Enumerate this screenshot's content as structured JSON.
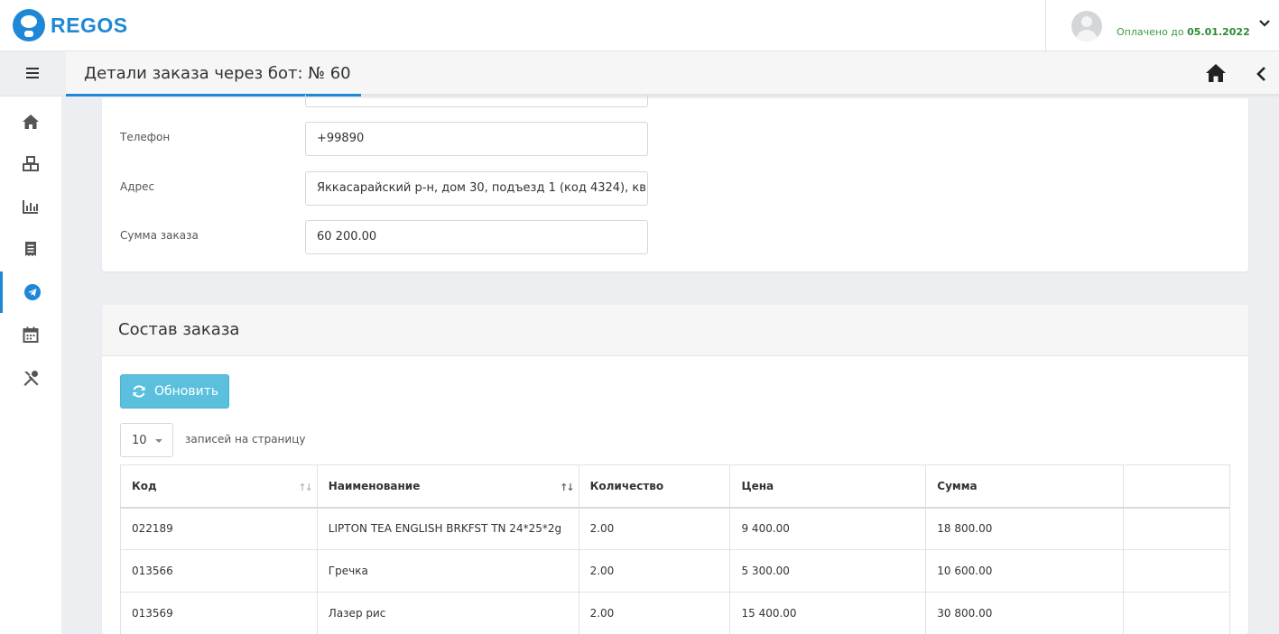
{
  "app": {
    "brand": "REGOS"
  },
  "header": {
    "paid_prefix": "Оплачено до",
    "paid_date": "05.01.2022"
  },
  "subheader": {
    "title": "Детали заказа через бот: № 60"
  },
  "order": {
    "fields": [
      {
        "label": "Телефон",
        "value": "+99890"
      },
      {
        "label": "Адрес",
        "value": "Яккасарайский р-н, дом 30, подъезд 1 (код 4324), кв."
      },
      {
        "label": "Сумма заказа",
        "value": "60 200.00"
      }
    ]
  },
  "items_panel": {
    "title": "Состав заказа",
    "refresh_label": "Обновить",
    "page_size": "10",
    "page_size_label": "записей на страницу",
    "columns": [
      "Код",
      "Наименование",
      "Количество",
      "Цена",
      "Сумма",
      ""
    ],
    "rows": [
      [
        "022189",
        "LIPTON TEA ENGLISH BRKFST TN 24*25*2g",
        "2.00",
        "9 400.00",
        "18 800.00",
        ""
      ],
      [
        "013566",
        "Гречка",
        "2.00",
        "5 300.00",
        "10 600.00",
        ""
      ],
      [
        "013569",
        "Лазер рис",
        "2.00",
        "15 400.00",
        "30 800.00",
        ""
      ]
    ]
  },
  "colors": {
    "accent": "#1e88d6",
    "refresh_button": "#5bc0de",
    "paid_text": "#3a9a3e"
  },
  "sidebar_icons": [
    "home-icon",
    "boxes-icon",
    "bar-chart-icon",
    "receipt-icon",
    "telegram-icon",
    "calendar-icon",
    "tools-icon"
  ]
}
